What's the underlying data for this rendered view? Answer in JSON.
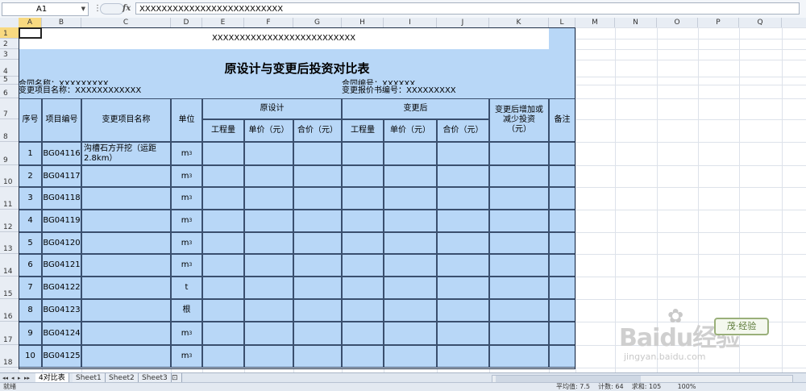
{
  "formula_bar": {
    "name_box": "A1",
    "fx": "fx",
    "formula": "XXXXXXXXXXXXXXXXXXXXXXXXXX"
  },
  "columns": [
    "A",
    "B",
    "C",
    "D",
    "E",
    "F",
    "G",
    "H",
    "I",
    "J",
    "K",
    "L",
    "M",
    "N",
    "O",
    "P",
    "Q"
  ],
  "rows": [
    "1",
    "2",
    "3",
    "4",
    "5",
    "6",
    "7",
    "8",
    "9",
    "10",
    "11",
    "12",
    "13",
    "14",
    "15",
    "16",
    "17",
    "18"
  ],
  "sheet": {
    "header_code": "XXXXXXXXXXXXXXXXXXXXXXXXXX",
    "title": "原设计与变更后投资对比表",
    "contract_name": "合同名称：XXXXXXXXX",
    "contract_no": "合同编号：XXXXXX",
    "change_item_name": "变更项目名称：XXXXXXXXXXXX",
    "change_report_no": "变更报价书编号：XXXXXXXXX",
    "hdr_seq": "序号",
    "hdr_item_code": "项目编号",
    "hdr_item_name": "变更项目名称",
    "hdr_unit": "单位",
    "hdr_original": "原设计",
    "hdr_changed": "变更后",
    "hdr_qty": "工程量",
    "hdr_price": "单价（元）",
    "hdr_total": "合价（元）",
    "hdr_diff": "变更后增加或减少投资（元）",
    "hdr_remark": "备注",
    "data_rows": [
      {
        "seq": "1",
        "code": "BG04116",
        "name": "沟槽石方开挖（运距2.8km）",
        "unit": "m",
        "sup": "3"
      },
      {
        "seq": "2",
        "code": "BG04117",
        "name": "",
        "unit": "m",
        "sup": "3"
      },
      {
        "seq": "3",
        "code": "BG04118",
        "name": "",
        "unit": "m",
        "sup": "3"
      },
      {
        "seq": "4",
        "code": "BG04119",
        "name": "",
        "unit": "m",
        "sup": "3"
      },
      {
        "seq": "5",
        "code": "BG04120",
        "name": "",
        "unit": "m",
        "sup": "3"
      },
      {
        "seq": "6",
        "code": "BG04121",
        "name": "",
        "unit": "m",
        "sup": "3"
      },
      {
        "seq": "7",
        "code": "BG04122",
        "name": "",
        "unit": "t",
        "sup": ""
      },
      {
        "seq": "8",
        "code": "BG04123",
        "name": "",
        "unit": "根",
        "sup": ""
      },
      {
        "seq": "9",
        "code": "BG04124",
        "name": "",
        "unit": "m",
        "sup": "3"
      },
      {
        "seq": "10",
        "code": "BG04125",
        "name": "",
        "unit": "m",
        "sup": "3"
      }
    ]
  },
  "tabs": {
    "nav": [
      "◂◂",
      "◂",
      "▸",
      "▸▸"
    ],
    "items": [
      "4对比表",
      "Sheet1",
      "Sheet2",
      "Sheet3"
    ],
    "new_tab_icon": "new-sheet-icon"
  },
  "status": {
    "left": "就绪",
    "right": "平均值: 7.5    计数: 64    求和: 105        100%"
  },
  "watermark": {
    "brand": "Baidu经验",
    "url": "jingyan.baidu.com",
    "logo": "茂·经验"
  },
  "colors": {
    "cell_fill": "#b8d7f7",
    "selection": "#f8d980",
    "border": "#3a4f6e"
  }
}
